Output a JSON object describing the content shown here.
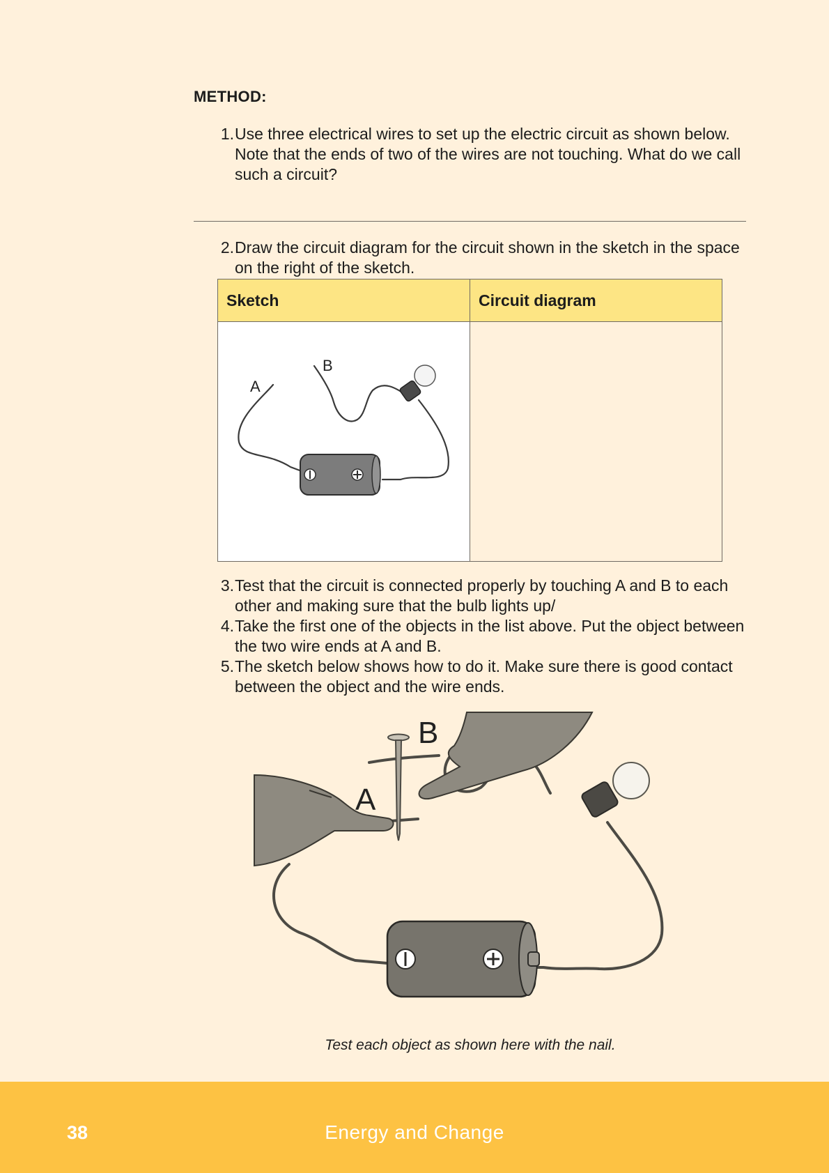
{
  "method": {
    "heading": "METHOD:",
    "steps": [
      {
        "number": "1.",
        "text": "Use three electrical wires to set up the electric circuit as shown below. Note that the ends of two of the wires are not touching. What do we call such a circuit?"
      },
      {
        "number": "2.",
        "text": "Draw the circuit diagram for the circuit shown in the sketch in the space on the right of the sketch."
      },
      {
        "number": "3.",
        "text": "Test that the circuit is connected properly by touching A and B to each other and making sure that the bulb lights up/"
      },
      {
        "number": "4.",
        "text": "Take the first one of the objects in the list above. Put the object between the two wire ends at A and B."
      },
      {
        "number": "5.",
        "text": "The sketch below shows how to do it. Make sure there is good contact between the object and the wire ends."
      }
    ]
  },
  "table": {
    "headers": [
      "Sketch",
      "Circuit diagram"
    ],
    "sketch_labels": {
      "a": "A",
      "b": "B"
    }
  },
  "illustration": {
    "labels": {
      "a": "A",
      "b": "B"
    },
    "caption": "Test each object as shown here with the nail."
  },
  "footer": {
    "page_number": "38",
    "book_title": "Energy and Change"
  }
}
